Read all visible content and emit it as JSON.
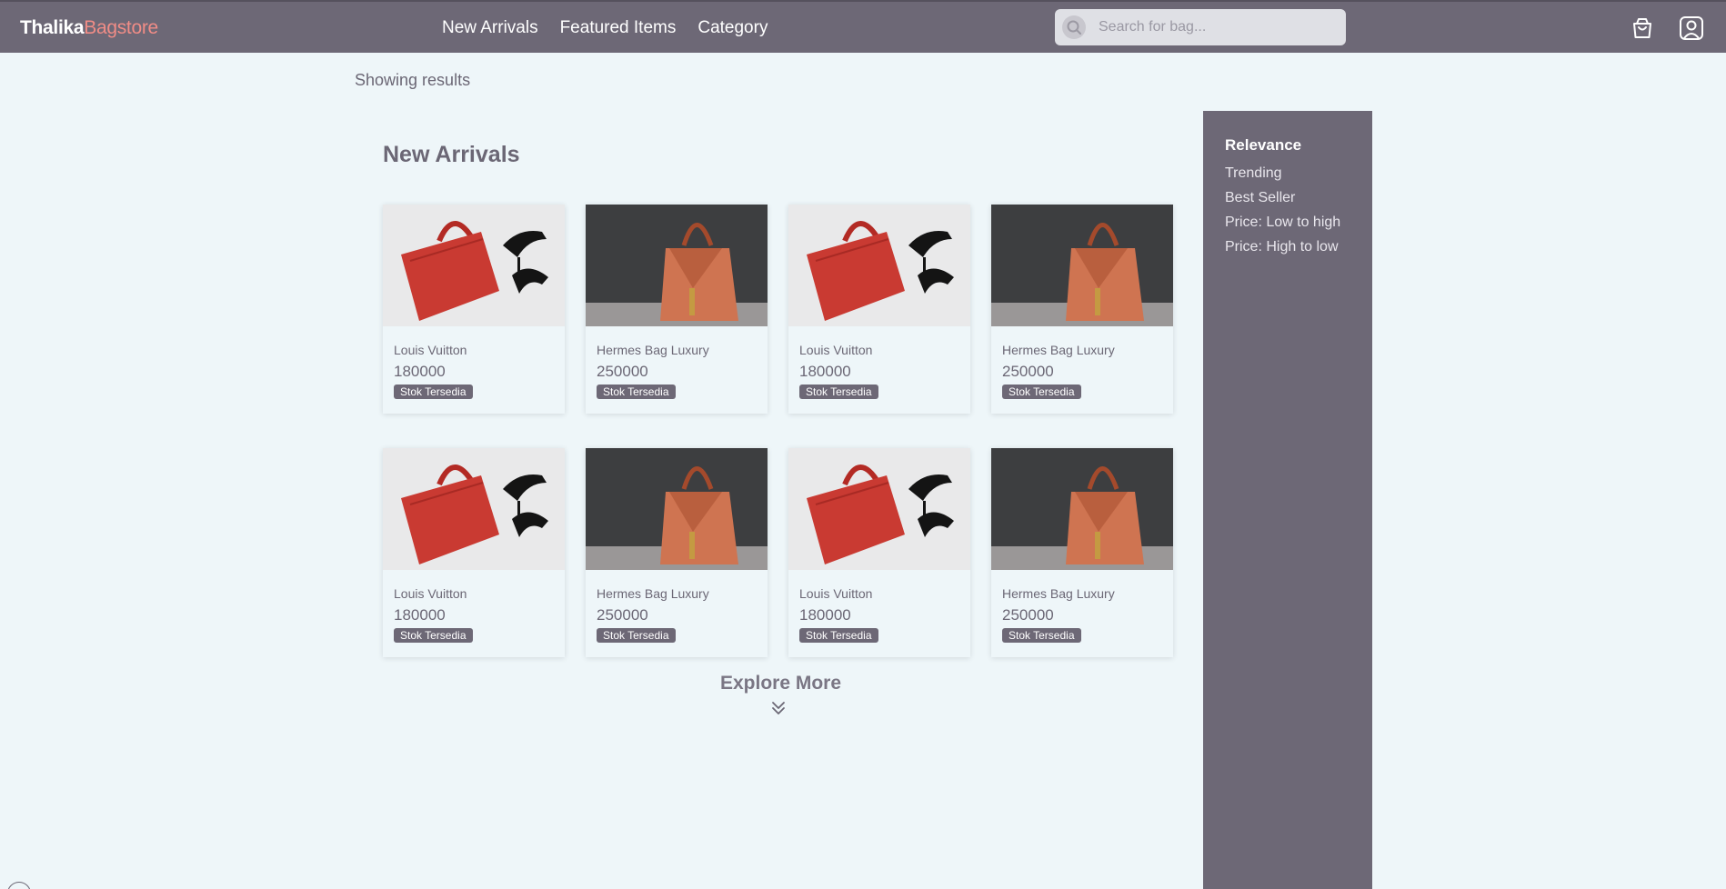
{
  "brand": {
    "part1": "Thalika",
    "part2": "Bagstore"
  },
  "nav": {
    "links": [
      "New Arrivals",
      "Featured Items",
      "Category"
    ]
  },
  "search": {
    "placeholder": "Search for bag...",
    "value": ""
  },
  "results": {
    "label": "Showing results"
  },
  "section": {
    "title": "New Arrivals"
  },
  "products": [
    {
      "name": "Louis Vuitton",
      "price": "180000",
      "stock": "Stok Tersedia",
      "image": "red-handbag"
    },
    {
      "name": "Hermes Bag Luxury",
      "price": "250000",
      "stock": "Stok Tersedia",
      "image": "orange-handbag"
    },
    {
      "name": "Louis Vuitton",
      "price": "180000",
      "stock": "Stok Tersedia",
      "image": "red-handbag"
    },
    {
      "name": "Hermes Bag Luxury",
      "price": "250000",
      "stock": "Stok Tersedia",
      "image": "orange-handbag"
    },
    {
      "name": "Louis Vuitton",
      "price": "180000",
      "stock": "Stok Tersedia",
      "image": "red-handbag"
    },
    {
      "name": "Hermes Bag Luxury",
      "price": "250000",
      "stock": "Stok Tersedia",
      "image": "orange-handbag"
    },
    {
      "name": "Louis Vuitton",
      "price": "180000",
      "stock": "Stok Tersedia",
      "image": "red-handbag"
    },
    {
      "name": "Hermes Bag Luxury",
      "price": "250000",
      "stock": "Stok Tersedia",
      "image": "orange-handbag"
    }
  ],
  "explore": {
    "label": "Explore More",
    "icon": "double-chevron-down-icon"
  },
  "sort": {
    "title": "Relevance",
    "items": [
      "Trending",
      "Best Seller",
      "Price: Low to high",
      "Price: High to low"
    ]
  },
  "icons": {
    "search": "search-icon",
    "cart": "shopping-bag-icon",
    "user": "user-profile-icon"
  },
  "colors": {
    "navbar": "#6d6876",
    "brand_accent": "#f08c86",
    "background": "#eef6f9",
    "badge": "#6d6876"
  }
}
